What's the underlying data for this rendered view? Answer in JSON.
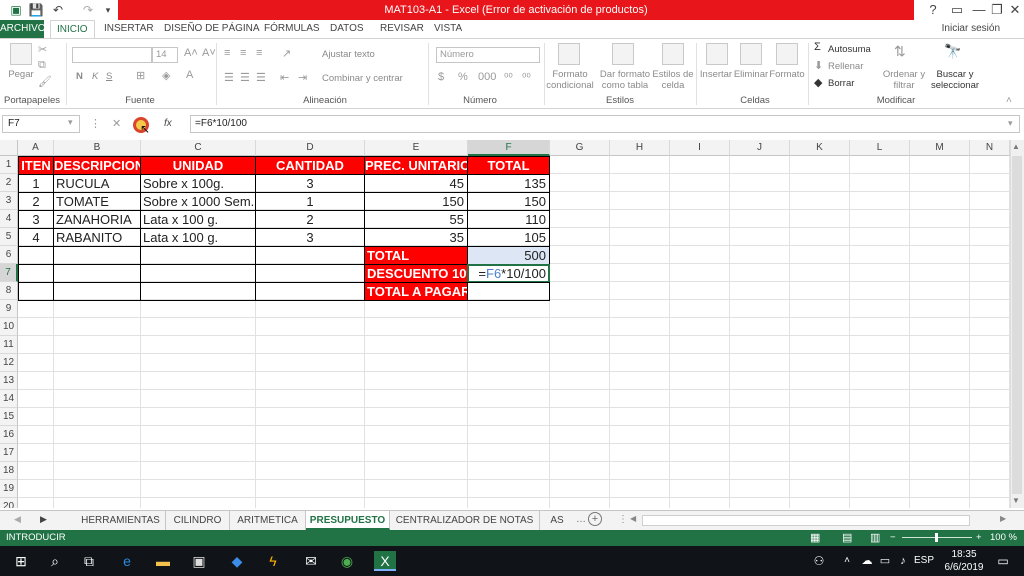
{
  "window": {
    "title": "MAT103-A1 -  Excel (Error de activación de productos)",
    "help": "?",
    "minimize": "—",
    "restore": "❐",
    "close": "✕"
  },
  "ribbon_tabs": [
    "ARCHIVO",
    "INICIO",
    "INSERTAR",
    "DISEÑO DE PÁGINA",
    "FÓRMULAS",
    "DATOS",
    "REVISAR",
    "VISTA"
  ],
  "signin": "Iniciar sesión",
  "ribbon": {
    "paste": "Pegar",
    "font_name": "",
    "font_size": "14",
    "bold": "N",
    "italic": "K",
    "underline": "S",
    "wrap_text": "Ajustar texto",
    "merge_center": "Combinar y centrar",
    "number_format": "Número",
    "cond_format": "Formato condicional",
    "format_table": "Dar formato como tabla",
    "cell_styles": "Estilos de celda",
    "insert": "Insertar",
    "delete": "Eliminar",
    "format": "Formato",
    "autosum": "Autosuma",
    "fill": "Rellenar",
    "clear": "Borrar",
    "sort_filter": "Ordenar y filtrar",
    "find_select": "Buscar y seleccionar",
    "groups": [
      "Portapapeles",
      "Fuente",
      "Alineación",
      "Número",
      "Estilos",
      "Celdas",
      "Modificar"
    ]
  },
  "formula_bar": {
    "name_box": "F7",
    "formula": "=F6*10/100",
    "fx": "fx"
  },
  "columns": [
    "A",
    "B",
    "C",
    "D",
    "E",
    "F",
    "G",
    "H",
    "I",
    "J",
    "K",
    "L",
    "M",
    "N"
  ],
  "rows": [
    "1",
    "2",
    "3",
    "4",
    "5",
    "6",
    "7",
    "8",
    "9",
    "10",
    "11",
    "12",
    "13",
    "14",
    "15",
    "16",
    "17",
    "18",
    "19",
    "20"
  ],
  "table": {
    "headers": [
      "ITEN",
      "DESCRIPCION",
      "UNIDAD",
      "CANTIDAD",
      "PREC. UNITARIO",
      "TOTAL"
    ],
    "rows": [
      {
        "item": "1",
        "desc": "RUCULA",
        "unit": "Sobre x 100g.",
        "qty": "3",
        "price": "45",
        "total": "135"
      },
      {
        "item": "2",
        "desc": "TOMATE",
        "unit": "Sobre x 1000 Sem.",
        "qty": "1",
        "price": "150",
        "total": "150"
      },
      {
        "item": "3",
        "desc": "ZANAHORIA",
        "unit": "Lata x 100 g.",
        "qty": "2",
        "price": "55",
        "total": "110"
      },
      {
        "item": "4",
        "desc": "RABANITO",
        "unit": "Lata x 100 g.",
        "qty": "3",
        "price": "35",
        "total": "105"
      }
    ],
    "summary": [
      {
        "label": "TOTAL",
        "value": "500"
      },
      {
        "label": "DESCUENTO 10%",
        "value_ref": "F6",
        "value_rest": "*10/100"
      },
      {
        "label": "TOTAL A PAGAR",
        "value": ""
      }
    ]
  },
  "sheets": [
    "HERRAMIENTAS",
    "CILINDRO",
    "ARITMETICA",
    "PRESUPUESTO",
    "CENTRALIZADOR DE NOTAS",
    "AS"
  ],
  "active_sheet": "PRESUPUESTO",
  "status": {
    "mode": "INTRODUCIR",
    "zoom": "100 %"
  },
  "taskbar": {
    "lang": "ESP",
    "time": "18:35",
    "date": "6/6/2019"
  },
  "colors": {
    "excel_green": "#217346",
    "title_red": "#e8151b",
    "header_red": "#ff0000",
    "formula_ref_blue": "#4a7fd0"
  }
}
